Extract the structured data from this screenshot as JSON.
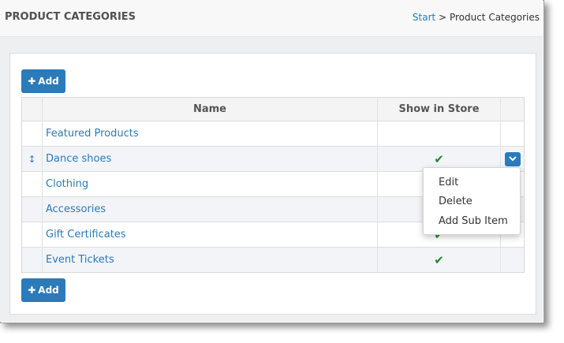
{
  "header": {
    "title": "PRODUCT CATEGORIES",
    "breadcrumb_link": "Start",
    "breadcrumb_sep": ">",
    "breadcrumb_current": "Product Categories"
  },
  "toolbar": {
    "add_icon": "plus-icon",
    "add_label": "Add"
  },
  "table": {
    "columns": [
      "Name",
      "Show in Store"
    ],
    "rows": [
      {
        "name": "Featured Products",
        "show_in_store": false
      },
      {
        "name": "Dance shoes",
        "show_in_store": true,
        "hovered": true
      },
      {
        "name": "Clothing",
        "show_in_store": true
      },
      {
        "name": "Accessories",
        "show_in_store": true
      },
      {
        "name": "Gift Certificates",
        "show_in_store": true
      },
      {
        "name": "Event Tickets",
        "show_in_store": true
      }
    ]
  },
  "row_menu": {
    "items": [
      "Edit",
      "Delete",
      "Add Sub Item"
    ]
  },
  "icons": {
    "check": "✔",
    "drag": "↕",
    "plus": "✚"
  },
  "colors": {
    "accent": "#2b7ab9",
    "link": "#2a7ab8",
    "check": "#1c8a2e"
  }
}
